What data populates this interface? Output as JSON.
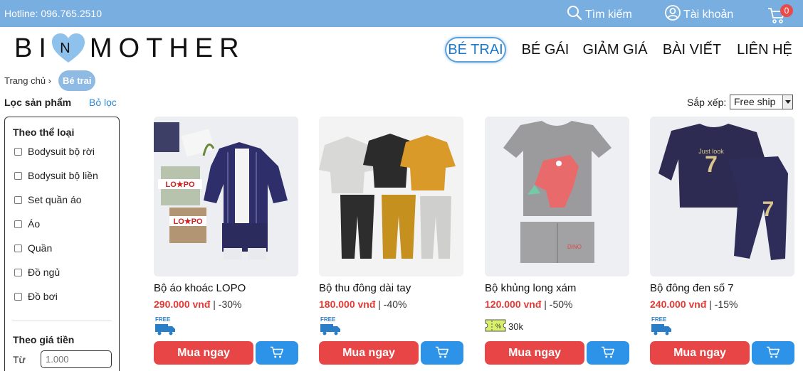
{
  "topbar": {
    "hotline": "Hotline: 096.765.2510",
    "search_label": "Tìm kiếm",
    "account_label": "Tài khoản",
    "cart_count": "0",
    "colors": {
      "bar": "#78aee0",
      "badge": "#e84b4b"
    }
  },
  "header": {
    "logo_left": "BI",
    "logo_right": "MOTHER",
    "logo_heart_color": "#8ec2ec",
    "nav": {
      "be_trai": "BÉ TRAI",
      "be_gai": "BÉ GÁI",
      "giam_gia": "GIẢM GIÁ",
      "bai_viet": "BÀI VIẾT",
      "lien_he": "LIÊN HỆ"
    },
    "active_nav": "be_trai"
  },
  "breadcrumb": {
    "home": "Trang chủ ›",
    "current": "Bé trai"
  },
  "filter": {
    "title": "Lọc sản phẩm",
    "clear": "Bỏ lọc",
    "category_heading": "Theo thể loại",
    "categories": [
      "Bodysuit bộ rời",
      "Bodysuit bộ liền",
      "Set quần áo",
      "Áo",
      "Quần",
      "Đồ ngủ",
      "Đồ bơi"
    ],
    "price_heading": "Theo giá tiền",
    "from_label": "Từ",
    "from_placeholder": "1.000"
  },
  "sort": {
    "label": "Sắp xếp:",
    "selected": "Free ship"
  },
  "products": [
    {
      "name": "Bộ áo khoác LOPO",
      "price": "290.000 vnđ",
      "discount": "| -30%",
      "shipping": "free-ship",
      "badge_text": "FREE",
      "buy_label": "Mua ngay"
    },
    {
      "name": "Bộ thu đông dài tay",
      "price": "180.000 vnđ",
      "discount": "| -40%",
      "shipping": "free-ship",
      "badge_text": "FREE",
      "buy_label": "Mua ngay"
    },
    {
      "name": "Bộ khủng long xám",
      "price": "120.000 vnđ",
      "discount": "| -50%",
      "shipping": "voucher",
      "badge_text": "30k",
      "buy_label": "Mua ngay"
    },
    {
      "name": "Bộ đông đen số 7",
      "price": "240.000 vnđ",
      "discount": "| -15%",
      "shipping": "free-ship",
      "badge_text": "FREE",
      "buy_label": "Mua ngay"
    }
  ]
}
